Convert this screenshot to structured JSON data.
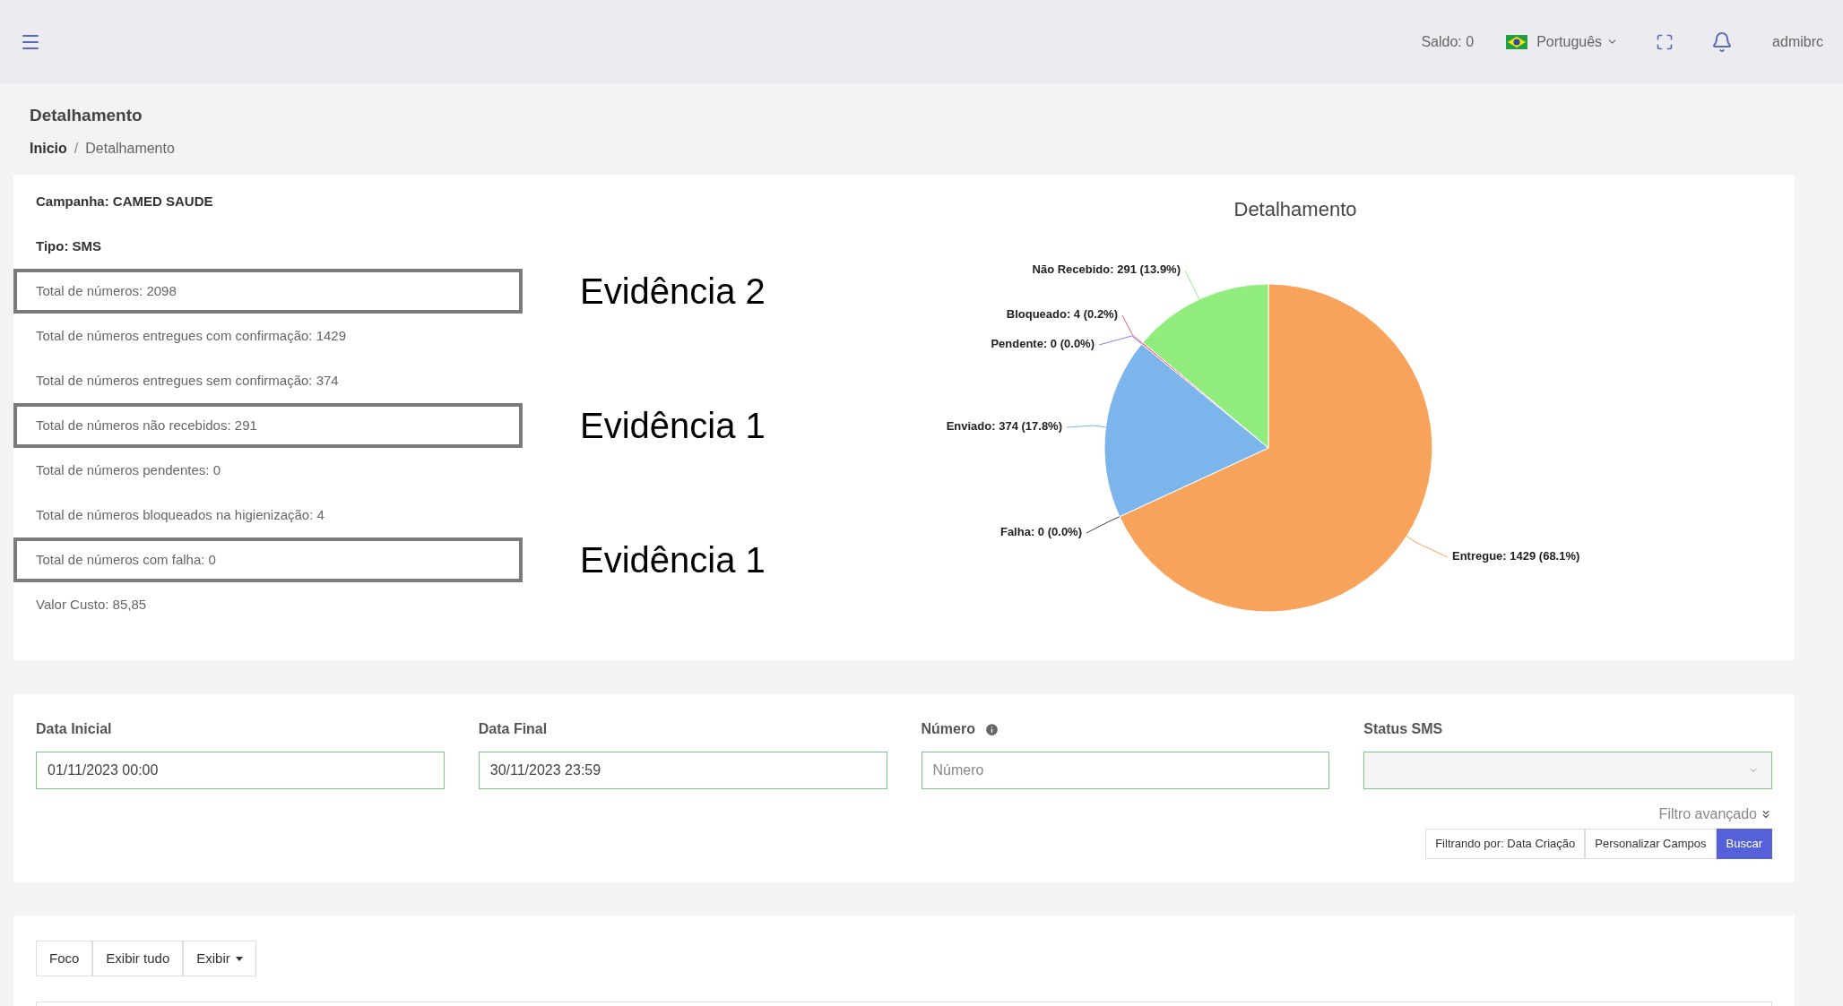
{
  "topbar": {
    "balance": "Saldo: 0",
    "language": "Português",
    "user": "admibrc"
  },
  "page": {
    "title": "Detalhamento",
    "breadcrumb_separator": "/",
    "breadcrumb": [
      {
        "label": "Inicio",
        "selected": false
      },
      {
        "label": "Detalhamento",
        "selected": true
      }
    ]
  },
  "summary": {
    "rows": [
      {
        "kind": "heading",
        "text": "Campanha: CAMED SAUDE",
        "highlighted": false
      },
      {
        "kind": "heading",
        "text": "Tipo: SMS",
        "highlighted": false
      },
      {
        "kind": "stat",
        "text": "Total de números: 2098",
        "highlighted": true,
        "annotation": "Evidência 2"
      },
      {
        "kind": "stat",
        "text": "Total de números entregues com confirmação: 1429",
        "highlighted": false
      },
      {
        "kind": "stat",
        "text": "Total de números entregues sem confirmação: 374",
        "highlighted": false
      },
      {
        "kind": "stat",
        "text": "Total de números não recebidos: 291",
        "highlighted": true,
        "annotation": "Evidência 1"
      },
      {
        "kind": "stat",
        "text": "Total de números pendentes: 0",
        "highlighted": false
      },
      {
        "kind": "stat",
        "text": "Total de números bloqueados na higienização: 4",
        "highlighted": false
      },
      {
        "kind": "stat",
        "text": "Total de números com falha: 0",
        "highlighted": true,
        "annotation": "Evidência 1"
      },
      {
        "kind": "stat",
        "text": "Valor Custo: 85,85",
        "highlighted": false
      }
    ]
  },
  "chart": {
    "chart_data": {
      "type": "pie",
      "title": "Detalhamento",
      "categories": [
        "Entregue",
        "Falha",
        "Enviado",
        "Pendente",
        "Bloqueado",
        "Não Recebido"
      ],
      "values": [
        1429,
        0,
        374,
        0,
        4,
        291
      ],
      "colors": [
        "#f7a35c",
        "#434348",
        "#7cb5ec",
        "#8085e9",
        "#f15c80",
        "#90ed7d"
      ],
      "value_labels": [
        ": 1429 (68.1%)",
        ": 0 (0.0%)",
        ": 374 (17.8%)",
        ": 0 (0.0%)",
        ": 4 (0.2%)",
        ": 291 (13.9%)"
      ]
    }
  },
  "filters": {
    "fields": [
      {
        "kind": "text",
        "label": "Data Inicial",
        "value": "01/11/2023 00:00",
        "info": false
      },
      {
        "kind": "text",
        "label": "Data Final",
        "value": "30/11/2023 23:59",
        "info": false
      },
      {
        "kind": "text",
        "label": "Número",
        "placeholder": "Número",
        "info": true
      },
      {
        "kind": "select",
        "label": "Status SMS",
        "info": false
      }
    ],
    "advanced_filter": "Filtro avançado",
    "buttons": [
      {
        "label": "Filtrando por: Data Criação",
        "primary": false
      },
      {
        "label": "Personalizar Campos",
        "primary": false
      },
      {
        "label": "Buscar",
        "primary": true
      }
    ]
  },
  "results": {
    "buttons": [
      {
        "label": "Foco",
        "kind": "button"
      },
      {
        "label": "Exibir tudo",
        "kind": "button"
      },
      {
        "label": "Exibir",
        "kind": "dropdown"
      }
    ]
  }
}
